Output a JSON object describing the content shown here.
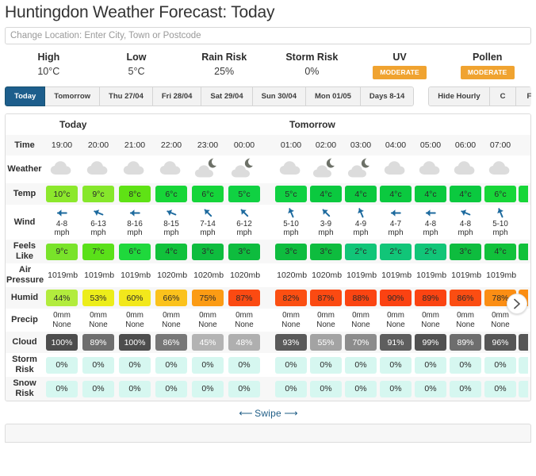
{
  "header": {
    "title": "Huntingdon Weather Forecast: Today",
    "location_placeholder": "Change Location: Enter City, Town or Postcode",
    "location_value": ""
  },
  "summary": [
    {
      "label": "High",
      "value": "10°C",
      "type": "text"
    },
    {
      "label": "Low",
      "value": "5°C",
      "type": "text"
    },
    {
      "label": "Rain Risk",
      "value": "25%",
      "type": "text"
    },
    {
      "label": "Storm Risk",
      "value": "0%",
      "type": "text"
    },
    {
      "label": "UV",
      "value": "MODERATE",
      "type": "badge",
      "color": "#f0a330"
    },
    {
      "label": "Pollen",
      "value": "MODERATE",
      "type": "badge",
      "color": "#f0a330"
    }
  ],
  "tabs": {
    "days": [
      {
        "label": "Today",
        "active": true
      },
      {
        "label": "Tomorrow",
        "active": false
      },
      {
        "label": "Thu 27/04",
        "active": false
      },
      {
        "label": "Fri 28/04",
        "active": false
      },
      {
        "label": "Sat 29/04",
        "active": false
      },
      {
        "label": "Sun 30/04",
        "active": false
      },
      {
        "label": "Mon 01/05",
        "active": false
      },
      {
        "label": "Days 8-14",
        "active": false
      }
    ],
    "controls": [
      {
        "label": "Hide Hourly",
        "active": false
      },
      {
        "label": "C",
        "active": false
      },
      {
        "label": "F",
        "active": false
      }
    ],
    "active_color": "#1d5e8c"
  },
  "forecast": {
    "row_labels": {
      "time": "Time",
      "weather": "Weather",
      "temp": "Temp",
      "wind": "Wind",
      "feels_like": "Feels Like",
      "air_pressure": "Air Pressure",
      "humid": "Humid",
      "precip": "Precip",
      "cloud": "Cloud",
      "storm_risk": "Storm Risk",
      "snow_risk": "Snow Risk"
    },
    "days": [
      {
        "name": "Today",
        "columns": [
          {
            "time": "19:00",
            "icon": "cloudy",
            "temp": "10°c",
            "temp_color": "#8ce82c",
            "wind_dir": "W",
            "wind_deg": 270,
            "wind": "4-8\nmph",
            "feels": "9°c",
            "feels_color": "#79e32a",
            "pressure": "1019mb",
            "humid": "44%",
            "humid_color": "#b2ec3d",
            "precip": "0mm\nNone",
            "cloud": "100%",
            "cloud_color": "#4d4d4d",
            "storm": "0%",
            "snow": "0%"
          },
          {
            "time": "20:00",
            "icon": "cloudy",
            "temp": "9°c",
            "temp_color": "#86e72b",
            "wind_dir": "WNW",
            "wind_deg": 295,
            "wind": "6-13\nmph",
            "feels": "7°c",
            "feels_color": "#5ae019",
            "pressure": "1019mb",
            "humid": "53%",
            "humid_color": "#eced1a",
            "precip": "0mm\nNone",
            "cloud": "89%",
            "cloud_color": "#6e6e6e",
            "storm": "0%",
            "snow": "0%"
          },
          {
            "time": "21:00",
            "icon": "cloudy",
            "temp": "8°c",
            "temp_color": "#5fe215",
            "wind_dir": "W",
            "wind_deg": 270,
            "wind": "8-16\nmph",
            "feels": "6°c",
            "feels_color": "#1fd83c",
            "pressure": "1019mb",
            "humid": "60%",
            "humid_color": "#f2e81c",
            "precip": "0mm\nNone",
            "cloud": "100%",
            "cloud_color": "#4d4d4d",
            "storm": "0%",
            "snow": "0%"
          },
          {
            "time": "22:00",
            "icon": "cloudy",
            "temp": "6°c",
            "temp_color": "#17d638",
            "wind_dir": "WNW",
            "wind_deg": 295,
            "wind": "8-15\nmph",
            "feels": "4°c",
            "feels_color": "#11c13b",
            "pressure": "1020mb",
            "humid": "66%",
            "humid_color": "#fbc21c",
            "precip": "0mm\nNone",
            "cloud": "86%",
            "cloud_color": "#777777",
            "storm": "0%",
            "snow": "0%"
          },
          {
            "time": "23:00",
            "icon": "cloudy-night",
            "temp": "6°c",
            "temp_color": "#15d53a",
            "wind_dir": "NW",
            "wind_deg": 315,
            "wind": "7-14\nmph",
            "feels": "3°c",
            "feels_color": "#0ebc3e",
            "pressure": "1020mb",
            "humid": "75%",
            "humid_color": "#fb9b14",
            "precip": "0mm\nNone",
            "cloud": "45%",
            "cloud_color": "#b3b3b3",
            "storm": "0%",
            "snow": "0%"
          },
          {
            "time": "00:00",
            "icon": "cloudy-night",
            "temp": "5°c",
            "temp_color": "#10d142",
            "wind_dir": "NW",
            "wind_deg": 315,
            "wind": "6-12\nmph",
            "feels": "3°c",
            "feels_color": "#0ebc3e",
            "pressure": "1020mb",
            "humid": "87%",
            "humid_color": "#fb4a12",
            "precip": "0mm\nNone",
            "cloud": "48%",
            "cloud_color": "#afafaf",
            "storm": "0%",
            "snow": "0%"
          }
        ]
      },
      {
        "name": "Tomorrow",
        "columns": [
          {
            "time": "01:00",
            "icon": "cloudy",
            "temp": "5°c",
            "temp_color": "#10d142",
            "wind_dir": "NNW",
            "wind_deg": 333,
            "wind": "5-10\nmph",
            "feels": "3°c",
            "feels_color": "#0ebc3e",
            "pressure": "1020mb",
            "humid": "82%",
            "humid_color": "#fb4f12",
            "precip": "0mm\nNone",
            "cloud": "93%",
            "cloud_color": "#5a5a5a",
            "storm": "0%",
            "snow": "0%"
          },
          {
            "time": "02:00",
            "icon": "cloudy-night",
            "temp": "4°c",
            "temp_color": "#0bc93f",
            "wind_dir": "NW",
            "wind_deg": 315,
            "wind": "3-9\nmph",
            "feels": "3°c",
            "feels_color": "#0ebc3e",
            "pressure": "1020mb",
            "humid": "87%",
            "humid_color": "#fb4a12",
            "precip": "0mm\nNone",
            "cloud": "55%",
            "cloud_color": "#a3a3a3",
            "storm": "0%",
            "snow": "0%"
          },
          {
            "time": "03:00",
            "icon": "cloudy-night",
            "temp": "4°c",
            "temp_color": "#0bc93f",
            "wind_dir": "NNW",
            "wind_deg": 333,
            "wind": "4-9\nmph",
            "feels": "2°c",
            "feels_color": "#11c578",
            "pressure": "1019mb",
            "humid": "88%",
            "humid_color": "#fb4512",
            "precip": "0mm\nNone",
            "cloud": "70%",
            "cloud_color": "#8c8c8c",
            "storm": "0%",
            "snow": "0%"
          },
          {
            "time": "04:00",
            "icon": "cloudy",
            "temp": "4°c",
            "temp_color": "#0bc93f",
            "wind_dir": "W",
            "wind_deg": 270,
            "wind": "4-7\nmph",
            "feels": "2°c",
            "feels_color": "#11c578",
            "pressure": "1019mb",
            "humid": "90%",
            "humid_color": "#fb4212",
            "precip": "0mm\nNone",
            "cloud": "91%",
            "cloud_color": "#5e5e5e",
            "storm": "0%",
            "snow": "0%"
          },
          {
            "time": "05:00",
            "icon": "cloudy",
            "temp": "4°c",
            "temp_color": "#0bc93f",
            "wind_dir": "W",
            "wind_deg": 270,
            "wind": "4-8\nmph",
            "feels": "2°c",
            "feels_color": "#11c578",
            "pressure": "1019mb",
            "humid": "89%",
            "humid_color": "#fb4412",
            "precip": "0mm\nNone",
            "cloud": "99%",
            "cloud_color": "#515151",
            "storm": "0%",
            "snow": "0%"
          },
          {
            "time": "06:00",
            "icon": "cloudy",
            "temp": "4°c",
            "temp_color": "#0bc93f",
            "wind_dir": "WNW",
            "wind_deg": 295,
            "wind": "4-8\nmph",
            "feels": "3°c",
            "feels_color": "#0ebc3e",
            "pressure": "1019mb",
            "humid": "86%",
            "humid_color": "#fb4d12",
            "precip": "0mm\nNone",
            "cloud": "89%",
            "cloud_color": "#6e6e6e",
            "storm": "0%",
            "snow": "0%"
          },
          {
            "time": "07:00",
            "icon": "cloudy",
            "temp": "6°c",
            "temp_color": "#17d638",
            "wind_dir": "NNW",
            "wind_deg": 333,
            "wind": "5-10\nmph",
            "feels": "4°c",
            "feels_color": "#11c13b",
            "pressure": "1019mb",
            "humid": "78%",
            "humid_color": "#fb8e14",
            "precip": "0mm\nNone",
            "cloud": "96%",
            "cloud_color": "#565656",
            "storm": "0%",
            "snow": "0%"
          }
        ]
      }
    ],
    "storm_chip_color": "#d6f7f0",
    "snow_chip_color": "#d6f7f0",
    "scroll_next_icon": "chevron-right-icon"
  },
  "swipe": {
    "left_arrow": "⟵",
    "label": "Swipe",
    "right_arrow": "⟶"
  },
  "bottom_panel": {
    "text": ""
  }
}
